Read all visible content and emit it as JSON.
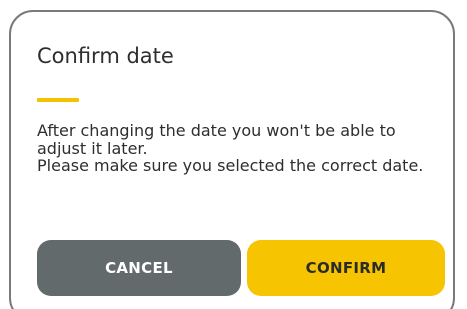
{
  "dialog": {
    "title": "Confirm date",
    "message_lines": [
      "After changing the date you won't be able to adjust it later.",
      "Please make sure you selected the correct date."
    ],
    "buttons": {
      "cancel_label": "CANCEL",
      "confirm_label": "CONFIRM"
    }
  },
  "colors": {
    "accent": "#f4c200",
    "cancel_button": "#626a6c",
    "confirm_button": "#f6c400",
    "border": "#7a7a7a",
    "text": "#2e2e2e"
  }
}
